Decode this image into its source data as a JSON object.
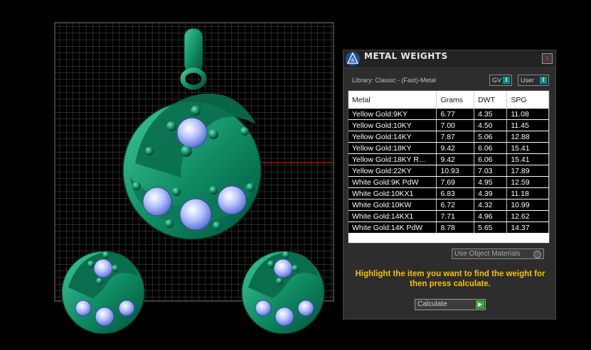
{
  "panel": {
    "title": "METAL WEIGHTS",
    "close_glyph": "x",
    "library_label": "Library: Classic - (Fast)-Metal",
    "toggle_gv": "GV",
    "toggle_user": "User",
    "toggle_btn_glyph": "I",
    "columns": [
      "Metal",
      "Grams",
      "DWT",
      "SPG"
    ],
    "rows": [
      [
        "Yellow Gold:9KY",
        "6.77",
        "4.35",
        "11.08"
      ],
      [
        "Yellow Gold:10KY",
        "7.00",
        "4.50",
        "11.45"
      ],
      [
        "Yellow Gold:14KY",
        "7.87",
        "5.06",
        "12.88"
      ],
      [
        "Yellow Gold:18KY",
        "9.42",
        "6.06",
        "15.41"
      ],
      [
        "Yellow Gold:18KY R...",
        "9.42",
        "6.06",
        "15.41"
      ],
      [
        "Yellow Gold:22KY",
        "10.93",
        "7.03",
        "17.89"
      ],
      [
        "White Gold:9K PdW",
        "7.69",
        "4.95",
        "12.59"
      ],
      [
        "White Gold:10KX1",
        "6.83",
        "4.39",
        "11.18"
      ],
      [
        "White Gold:10KW",
        "6.72",
        "4.32",
        "10.99"
      ],
      [
        "White Gold:14KX1",
        "7.71",
        "4.96",
        "12.62"
      ],
      [
        "White Gold:14K PdW",
        "8.78",
        "5.65",
        "14.37"
      ]
    ],
    "use_object_materials": "Use Object Materials",
    "hint_text": "Highlight the item you want to find the weight for then press calculate.",
    "calculate_label": "Calculate",
    "calculate_arrow": "▶"
  },
  "colors": {
    "metal_green": "#0e8a62",
    "gem_blue": "#a9b8ff",
    "grid": "#6a6a6a",
    "hint_yellow": "#f2c200",
    "accent_teal": "#0d8f8f"
  },
  "icons": [
    "app-logo-icon",
    "close-icon",
    "toggle-icon",
    "checkbox-icon",
    "play-arrow-icon"
  ]
}
